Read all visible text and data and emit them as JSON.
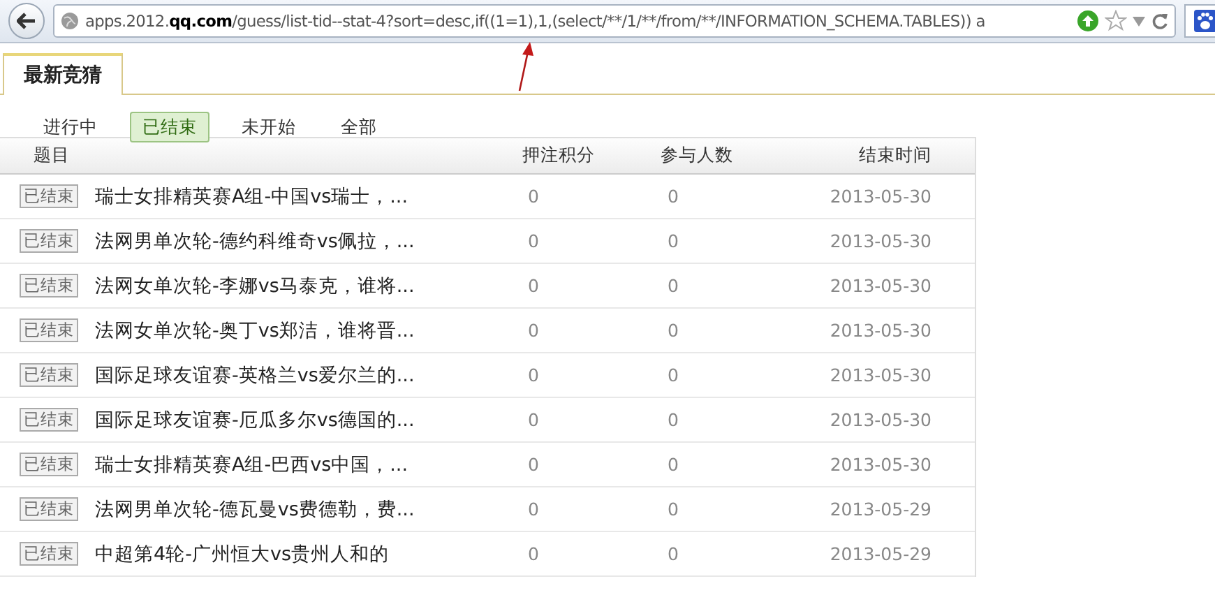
{
  "browser": {
    "url_prefix": "apps.2012.",
    "url_domain": "qq.com",
    "url_path": "/guess/list-tid--stat-4?sort=desc,if((1=1),1,(select/**/1/**/from/**/INFORMATION_SCHEMA.TABLES)) a"
  },
  "tabs": [
    {
      "label": "最新竞猜",
      "selected": true
    }
  ],
  "filters": [
    {
      "label": "进行中",
      "selected": false
    },
    {
      "label": "已结束",
      "selected": true
    },
    {
      "label": "未开始",
      "selected": false
    },
    {
      "label": "全部",
      "selected": false
    }
  ],
  "table": {
    "columns": [
      "题目",
      "押注积分",
      "参与人数",
      "结束时间"
    ],
    "rows": [
      {
        "status": "已结束",
        "title": "瑞士女排精英赛A组-中国vs瑞士，...",
        "points": "0",
        "participants": "0",
        "end_time": "2013-05-30"
      },
      {
        "status": "已结束",
        "title": "法网男单次轮-德约科维奇vs佩拉，...",
        "points": "0",
        "participants": "0",
        "end_time": "2013-05-30"
      },
      {
        "status": "已结束",
        "title": "法网女单次轮-李娜vs马泰克，谁将...",
        "points": "0",
        "participants": "0",
        "end_time": "2013-05-30"
      },
      {
        "status": "已结束",
        "title": "法网女单次轮-奥丁vs郑洁，谁将晋...",
        "points": "0",
        "participants": "0",
        "end_time": "2013-05-30"
      },
      {
        "status": "已结束",
        "title": "国际足球友谊赛-英格兰vs爱尔兰的...",
        "points": "0",
        "participants": "0",
        "end_time": "2013-05-30"
      },
      {
        "status": "已结束",
        "title": "国际足球友谊赛-厄瓜多尔vs德国的...",
        "points": "0",
        "participants": "0",
        "end_time": "2013-05-30"
      },
      {
        "status": "已结束",
        "title": "瑞士女排精英赛A组-巴西vs中国，...",
        "points": "0",
        "participants": "0",
        "end_time": "2013-05-30"
      },
      {
        "status": "已结束",
        "title": "法网男单次轮-德瓦曼vs费德勒，费...",
        "points": "0",
        "participants": "0",
        "end_time": "2013-05-29"
      },
      {
        "status": "已结束",
        "title": "中超第4轮-广州恒大vs贵州人和的",
        "points": "0",
        "participants": "0",
        "end_time": "2013-05-29"
      }
    ]
  }
}
